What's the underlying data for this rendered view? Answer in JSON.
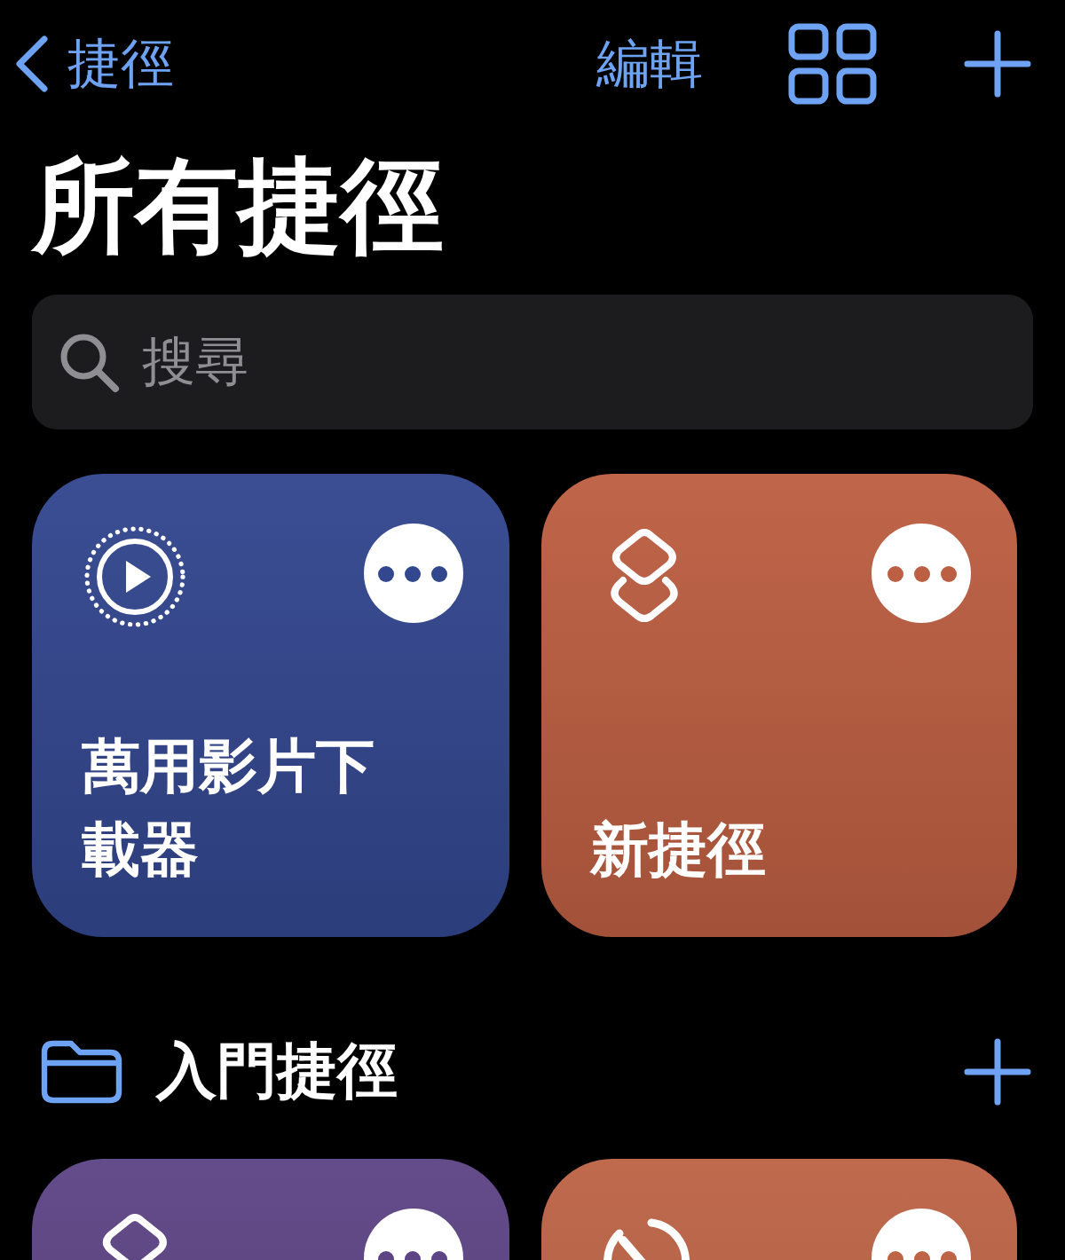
{
  "nav": {
    "back_label": "捷徑",
    "edit_label": "編輯"
  },
  "title": "所有捷徑",
  "search": {
    "placeholder": "搜尋"
  },
  "cards": [
    {
      "title": "萬用影片下載器",
      "color": "#33478f",
      "kind": "video"
    },
    {
      "title": "新捷徑",
      "color": "#bd5f42",
      "kind": "shortcut"
    }
  ],
  "section": {
    "title": "入門捷徑",
    "cards": [
      {
        "color": "#5d4585",
        "kind": "shortcut"
      },
      {
        "color": "#bd6446",
        "kind": "timer"
      }
    ]
  }
}
